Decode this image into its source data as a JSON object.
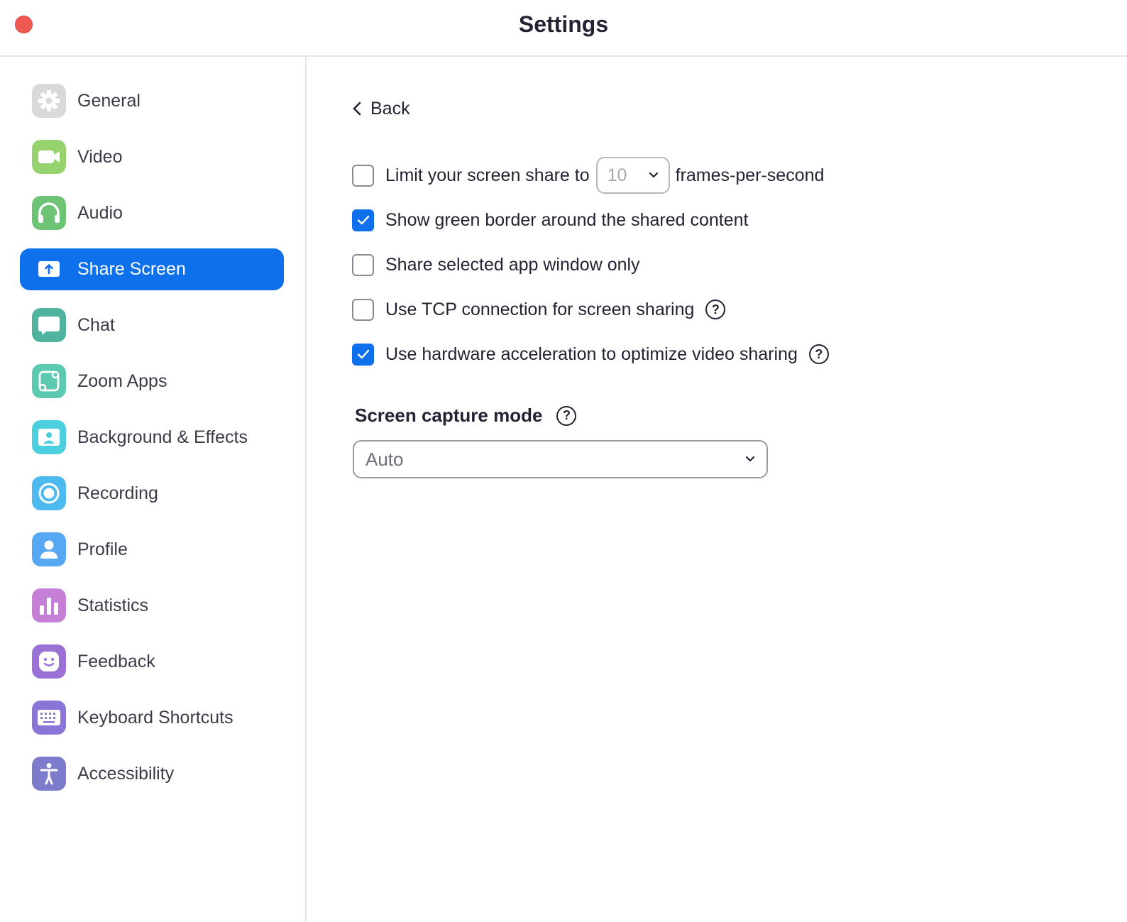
{
  "window": {
    "title": "Settings"
  },
  "sidebar": {
    "items": [
      {
        "label": "General",
        "icon": "gear-icon",
        "color": "#d9d9dc",
        "active": false
      },
      {
        "label": "Video",
        "icon": "video-camera-icon",
        "color": "#96d36f",
        "active": false
      },
      {
        "label": "Audio",
        "icon": "headphones-icon",
        "color": "#6cc474",
        "active": false
      },
      {
        "label": "Share Screen",
        "icon": "share-screen-icon",
        "color": "#0e71eb",
        "active": true
      },
      {
        "label": "Chat",
        "icon": "chat-bubble-icon",
        "color": "#4fb3a0",
        "active": false
      },
      {
        "label": "Zoom Apps",
        "icon": "apps-icon",
        "color": "#5ccab0",
        "active": false
      },
      {
        "label": "Background & Effects",
        "icon": "background-person-icon",
        "color": "#4cd0e0",
        "active": false
      },
      {
        "label": "Recording",
        "icon": "record-icon",
        "color": "#4cb9ef",
        "active": false
      },
      {
        "label": "Profile",
        "icon": "person-icon",
        "color": "#57a8f3",
        "active": false
      },
      {
        "label": "Statistics",
        "icon": "bar-chart-icon",
        "color": "#c57fd6",
        "active": false
      },
      {
        "label": "Feedback",
        "icon": "smiley-icon",
        "color": "#9a72d6",
        "active": false
      },
      {
        "label": "Keyboard Shortcuts",
        "icon": "keyboard-icon",
        "color": "#8a74d8",
        "active": false
      },
      {
        "label": "Accessibility",
        "icon": "accessibility-icon",
        "color": "#7d7ccc",
        "active": false
      }
    ]
  },
  "main": {
    "back_label": "Back",
    "options": [
      {
        "label_before": "Limit your screen share to",
        "select_value": "10",
        "label_after": "frames-per-second",
        "checked": false,
        "help": false
      },
      {
        "label": "Show green border around the shared content",
        "checked": true,
        "help": false
      },
      {
        "label": "Share selected app window only",
        "checked": false,
        "help": false
      },
      {
        "label": "Use TCP connection for screen sharing",
        "checked": false,
        "help": true
      },
      {
        "label": "Use hardware acceleration to optimize video sharing",
        "checked": true,
        "help": true
      }
    ],
    "capture_mode": {
      "title": "Screen capture mode",
      "value": "Auto"
    },
    "help_glyph": "?"
  },
  "colors": {
    "accent": "#0e71eb",
    "close_button": "#ee5a52"
  }
}
